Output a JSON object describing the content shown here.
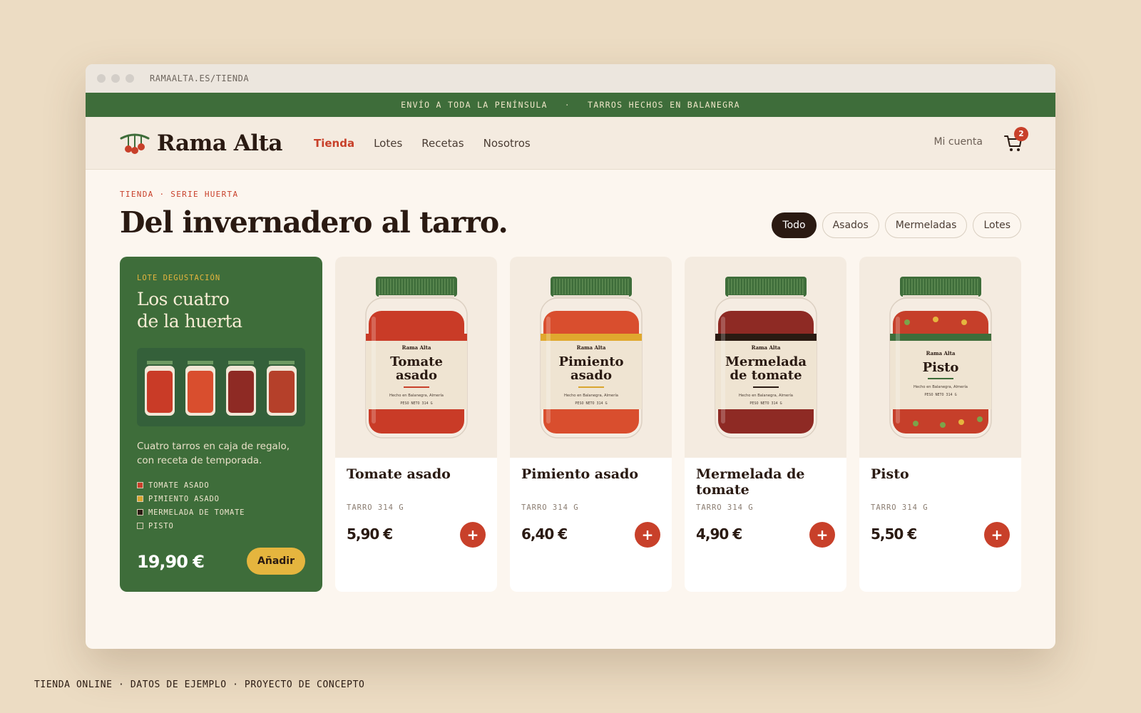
{
  "browser": {
    "url": "RAMAALTA.ES/TIENDA"
  },
  "promo_bar": {
    "left": "ENVÍO A TODA LA PENÍNSULA",
    "separator": "·",
    "right": "TARROS HECHOS EN BALANEGRA"
  },
  "header": {
    "brand": "Rama Alta",
    "nav": [
      {
        "label": "Tienda",
        "active": true
      },
      {
        "label": "Lotes",
        "active": false
      },
      {
        "label": "Recetas",
        "active": false
      },
      {
        "label": "Nosotros",
        "active": false
      }
    ],
    "account": "Mi cuenta",
    "cart_count": "2"
  },
  "page": {
    "breadcrumb": "TIENDA · SERIE HUERTA",
    "title": "Del invernadero al tarro.",
    "filters": [
      {
        "label": "Todo",
        "active": true
      },
      {
        "label": "Asados",
        "active": false
      },
      {
        "label": "Mermeladas",
        "active": false
      },
      {
        "label": "Lotes",
        "active": false
      }
    ]
  },
  "featured": {
    "kicker": "LOTE DEGUSTACIÓN",
    "title_line1": "Los cuatro",
    "title_line2": "de la huerta",
    "description": "Cuatro tarros en caja de regalo, con receta de temporada.",
    "items": [
      {
        "label": "TOMATE ASADO",
        "color": "#c8402a"
      },
      {
        "label": "PIMIENTO ASADO",
        "color": "#d9a52e"
      },
      {
        "label": "MERMELADA DE TOMATE",
        "color": "#2a1a12"
      },
      {
        "label": "PISTO",
        "color": "#3e6d3a"
      }
    ],
    "price": "19,90 €",
    "add_label": "Añadir"
  },
  "products": [
    {
      "name": "Tomate asado",
      "label_line1": "Tomate",
      "label_line2": "asado",
      "meta": "TARRO 314 G",
      "price": "5,90 €",
      "add": "+",
      "fill": "#c93b27",
      "band": "#c93b27",
      "accent": "#c8402a",
      "icon": "jar-tomate-asado-icon"
    },
    {
      "name": "Pimiento asado",
      "label_line1": "Pimiento",
      "label_line2": "asado",
      "meta": "TARRO 314 G",
      "price": "6,40 €",
      "add": "+",
      "fill": "#d94e2e",
      "band": "#e0a82e",
      "accent": "#d9a52e",
      "icon": "jar-pimiento-asado-icon"
    },
    {
      "name": "Mermelada de tomate",
      "label_line1": "Mermelada",
      "label_line2": "de tomate",
      "meta": "TARRO 314 G",
      "price": "4,90 €",
      "add": "+",
      "fill": "#8e2a24",
      "band": "#2a1a12",
      "accent": "#2a1a12",
      "icon": "jar-mermelada-tomate-icon"
    },
    {
      "name": "Pisto",
      "label_line1": "Pisto",
      "label_line2": "",
      "meta": "TARRO 314 G",
      "price": "5,50 €",
      "add": "+",
      "fill": "#c63f2a",
      "band": "#3e6d3a",
      "accent": "#3e6d3a",
      "icon": "jar-pisto-icon"
    }
  ],
  "jar_label": {
    "brand": "Rama Alta",
    "origin": "Hecho en Balanegra, Almería",
    "weight": "PESO NETO 314 G"
  },
  "footnote": "TIENDA ONLINE · DATOS DE EJEMPLO · PROYECTO DE CONCEPTO"
}
